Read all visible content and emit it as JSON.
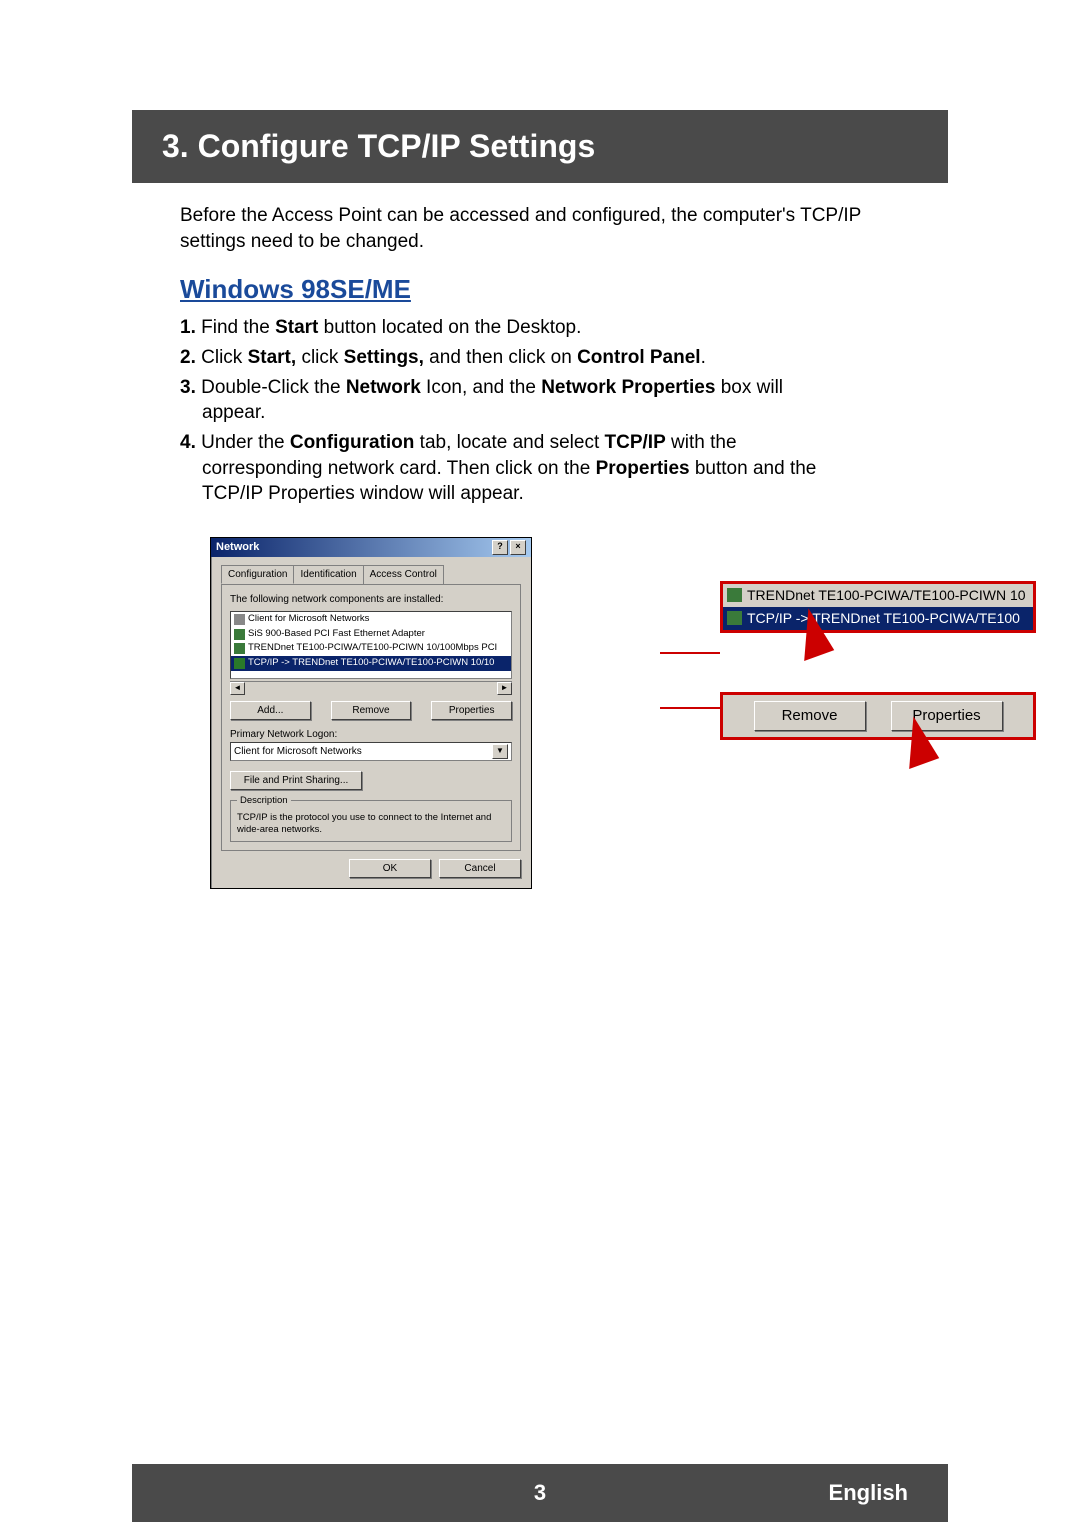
{
  "header": {
    "title": "3. Configure TCP/IP Settings"
  },
  "intro": "Before the Access Point can be accessed and configured, the computer's TCP/IP settings need to be changed.",
  "subhead": "Windows 98SE/ME",
  "steps": {
    "s1": {
      "num": "1.",
      "a": " Find the ",
      "b1": "Start",
      "c": " button located on the Desktop."
    },
    "s2": {
      "num": "2.",
      "a": " Click ",
      "b1": "Start,",
      "c": " click ",
      "b2": "Settings,",
      "d": " and then click on ",
      "b3": "Control Panel",
      "e": "."
    },
    "s3": {
      "num": "3.",
      "a": " Double-Click the ",
      "b1": "Network",
      "c": " Icon, and the ",
      "b2": "Network Properties",
      "d": " box will",
      "cont": "appear."
    },
    "s4": {
      "num": "4.",
      "a": " Under the ",
      "b1": "Configuration",
      "c": " tab, locate and select ",
      "b2": "TCP/IP",
      "d": " with the",
      "cont1": "corresponding network card. Then click on the ",
      "b3": "Properties",
      "cont2": " button and the",
      "cont3": "TCP/IP Properties window will appear."
    }
  },
  "dialog": {
    "title": "Network",
    "help": "?",
    "close": "×",
    "tabs": {
      "t1": "Configuration",
      "t2": "Identification",
      "t3": "Access Control"
    },
    "list_label": "The following network components are installed:",
    "items": {
      "i1": "Client for Microsoft Networks",
      "i2": "SiS 900-Based PCI Fast Ethernet Adapter",
      "i3": "TRENDnet TE100-PCIWA/TE100-PCIWN 10/100Mbps PCI",
      "i4": "TCP/IP -> TRENDnet TE100-PCIWA/TE100-PCIWN 10/10"
    },
    "btns": {
      "add": "Add...",
      "remove": "Remove",
      "props": "Properties"
    },
    "logon_label": "Primary Network Logon:",
    "logon_val": "Client for Microsoft Networks",
    "fps": "File and Print Sharing...",
    "desc_legend": "Description",
    "desc_text": "TCP/IP is the protocol you use to connect to the Internet and wide-area networks.",
    "ok": "OK",
    "cancel": "Cancel"
  },
  "callout1": {
    "line1": "TRENDnet TE100-PCIWA/TE100-PCIWN 10",
    "line2": "TCP/IP -> TRENDnet TE100-PCIWA/TE100"
  },
  "callout2": {
    "remove": "Remove",
    "props": "Properties"
  },
  "footer": {
    "page": "3",
    "lang": "English"
  }
}
